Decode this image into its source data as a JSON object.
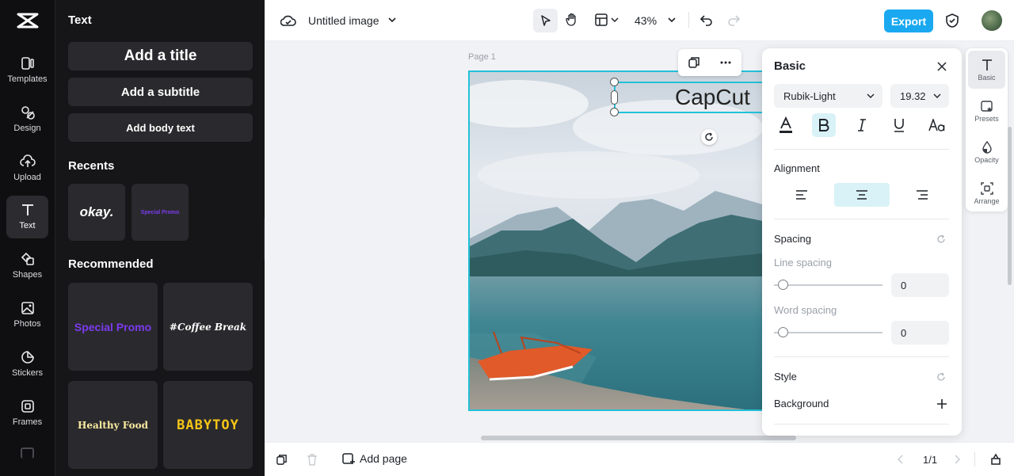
{
  "app": {
    "brand_icon": "capcut-logo"
  },
  "rail": {
    "items": [
      {
        "label": "Templates",
        "icon": "templates-icon"
      },
      {
        "label": "Design",
        "icon": "design-icon"
      },
      {
        "label": "Upload",
        "icon": "upload-icon"
      },
      {
        "label": "Text",
        "icon": "text-icon",
        "active": true
      },
      {
        "label": "Shapes",
        "icon": "shapes-icon"
      },
      {
        "label": "Photos",
        "icon": "photos-icon"
      },
      {
        "label": "Stickers",
        "icon": "stickers-icon"
      },
      {
        "label": "Frames",
        "icon": "frames-icon"
      }
    ]
  },
  "panel": {
    "title": "Text",
    "add_title": "Add a title",
    "add_subtitle": "Add a subtitle",
    "add_body": "Add body text",
    "recents_label": "Recents",
    "recents": [
      "okay.",
      "Special Promo"
    ],
    "recommended_label": "Recommended",
    "recommended": [
      "Special Promo",
      "#Coffee Break",
      "Healthy Food",
      "BABYTOY"
    ]
  },
  "topbar": {
    "doc_title": "Untitled image",
    "zoom": "43%",
    "export_label": "Export",
    "accent": "#1aa9f0"
  },
  "canvas": {
    "page_label": "Page 1",
    "text_content": "CapCut",
    "selection_color": "#22c0d8"
  },
  "bottombar": {
    "add_page": "Add page",
    "page_indicator": "1/1"
  },
  "props": {
    "header": "Basic",
    "font": "Rubik-Light",
    "size": "19.32",
    "alignment_label": "Alignment",
    "alignment_selected": "center",
    "spacing_label": "Spacing",
    "line_spacing_label": "Line spacing",
    "line_spacing_value": "0",
    "word_spacing_label": "Word spacing",
    "word_spacing_value": "0",
    "style_label": "Style",
    "background_label": "Background"
  },
  "side_tabs": [
    {
      "label": "Basic",
      "icon": "text-icon",
      "active": true
    },
    {
      "label": "Presets",
      "icon": "presets-icon"
    },
    {
      "label": "Opacity",
      "icon": "opacity-icon"
    },
    {
      "label": "Arrange",
      "icon": "arrange-icon"
    }
  ]
}
